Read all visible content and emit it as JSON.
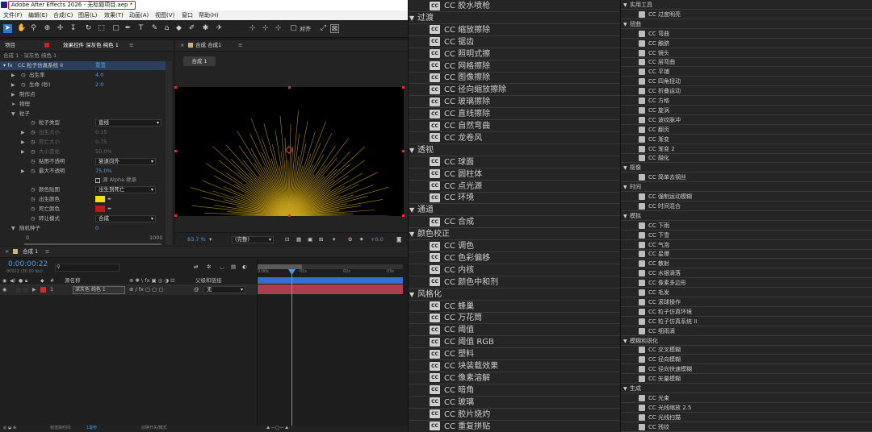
{
  "window": {
    "title": "Adobe After Effects 2026 - 无标题项目.aep *"
  },
  "menu": [
    "文件(F)",
    "编辑(E)",
    "合成(C)",
    "图层(L)",
    "效果(T)",
    "动画(A)",
    "视图(V)",
    "窗口",
    "帮助(H)"
  ],
  "toolbar": {
    "align_label": "对齐"
  },
  "project_panel": {
    "tab_project": "项目",
    "tab_effects": "效果控件 深灰色 纯色 1",
    "breadcrumb": "合成 1 · 深灰色 纯色 1",
    "effect_name": "CC 粒子仿真系统 II",
    "reset_label": "重置",
    "props": [
      {
        "label": "出生率",
        "value": "4.0"
      },
      {
        "label": "生命 (秒)",
        "value": "2.0"
      },
      {
        "label": "制作点",
        "value": ""
      },
      {
        "label": "物理",
        "value": ""
      },
      {
        "label": "粒子",
        "value": ""
      }
    ],
    "particle": {
      "type_label": "粒子类型",
      "type_value": "直线",
      "birth_size_label": "出生大小",
      "birth_size": "0.15",
      "death_size_label": "死亡大小",
      "death_size": "0.75",
      "size_var_label": "大小变化",
      "size_var": "50.0%",
      "opacity_map_label": "贴图不透明",
      "opacity_map_value": "衰退向外",
      "max_opacity_label": "最大不透明",
      "max_opacity": "75.0%",
      "alpha_label": "源 Alpha 继承",
      "color_map_label": "颜色贴图",
      "color_map_value": "出生到死亡",
      "birth_color_label": "出生颜色",
      "birth_color": "#f0e010",
      "death_color_label": "死亡颜色",
      "death_color": "#c01818",
      "transfer_label": "转让模式",
      "transfer_value": "合成"
    },
    "random_label": "随机种子",
    "random_value": "0",
    "slider_min": "0",
    "slider_max": "1000"
  },
  "viewer": {
    "tab_label": "合成 合成1",
    "comp_button": "合成 1",
    "zoom": "83.7 %",
    "quality": "(完整)",
    "exposure": "+0.0"
  },
  "timeline": {
    "tab_label": "合成 1",
    "timecode": "0:00:00:22",
    "timecode_sub": "00022 (30.00 fps)",
    "search_placeholder": "",
    "col_source": "源名称",
    "col_parent": "父级和链接",
    "layer_num": "1",
    "layer_name": "深灰色 纯色 1",
    "layer_parent": "无",
    "ruler": [
      "0:00s",
      "01s",
      "02s",
      "03s"
    ],
    "footer_render_label": "帧渲染时间:",
    "footer_render_value": "1毫秒",
    "footer_switch": "切换开关/模式"
  },
  "effects_list_left": [
    {
      "type": "item",
      "label": "CC 胶水喷枪"
    },
    {
      "type": "cat",
      "label": "过渡"
    },
    {
      "type": "item",
      "label": "CC 缩放擦除"
    },
    {
      "type": "item",
      "label": "CC 锯齿"
    },
    {
      "type": "item",
      "label": "CC 照明式擦"
    },
    {
      "type": "item",
      "label": "CC 网格擦除"
    },
    {
      "type": "item",
      "label": "CC 图像擦除"
    },
    {
      "type": "item",
      "label": "CC 径向缩放擦除"
    },
    {
      "type": "item",
      "label": "CC 玻璃擦除"
    },
    {
      "type": "item",
      "label": "CC 直线擦除"
    },
    {
      "type": "item",
      "label": "CC 自然弯曲"
    },
    {
      "type": "item",
      "label": "CC 龙卷风"
    },
    {
      "type": "cat",
      "label": "透视"
    },
    {
      "type": "item",
      "label": "CC 球面"
    },
    {
      "type": "item",
      "label": "CC 圆柱体"
    },
    {
      "type": "item",
      "label": "CC 点光源"
    },
    {
      "type": "item",
      "label": "CC 环境"
    },
    {
      "type": "cat",
      "label": "通道"
    },
    {
      "type": "item",
      "label": "CC 合成"
    },
    {
      "type": "cat",
      "label": "颜色校正"
    },
    {
      "type": "item",
      "label": "CC 调色"
    },
    {
      "type": "item",
      "label": "CC 色彩偏移"
    },
    {
      "type": "item",
      "label": "CC 内核"
    },
    {
      "type": "item",
      "label": "CC 颜色中和剂"
    },
    {
      "type": "cat",
      "label": "风格化"
    },
    {
      "type": "item",
      "label": "CC 蜂巢"
    },
    {
      "type": "item",
      "label": "CC 万花筒"
    },
    {
      "type": "item",
      "label": "CC 阈值"
    },
    {
      "type": "item",
      "label": "CC 阈值 RGB"
    },
    {
      "type": "item",
      "label": "CC 塑料"
    },
    {
      "type": "item",
      "label": "CC 块装载效果"
    },
    {
      "type": "item",
      "label": "CC 像素溶解"
    },
    {
      "type": "item",
      "label": "CC 暗角"
    },
    {
      "type": "item",
      "label": "CC 玻璃"
    },
    {
      "type": "item",
      "label": "CC 胶片烧灼"
    },
    {
      "type": "item",
      "label": "CC 重复拼贴"
    }
  ],
  "effects_list_right": [
    {
      "type": "cat",
      "label": "实用工具"
    },
    {
      "type": "item",
      "label": "CC 过度明亮"
    },
    {
      "type": "cat",
      "label": "扭曲"
    },
    {
      "type": "item",
      "label": "CC 弯曲"
    },
    {
      "type": "item",
      "label": "CC 触脐"
    },
    {
      "type": "item",
      "label": "CC 镜头"
    },
    {
      "type": "item",
      "label": "CC 层弯曲"
    },
    {
      "type": "item",
      "label": "CC 平铺"
    },
    {
      "type": "item",
      "label": "CC 四角扭动"
    },
    {
      "type": "item",
      "label": "CC 折叠运动"
    },
    {
      "type": "item",
      "label": "CC 方格"
    },
    {
      "type": "item",
      "label": "CC 旋涡"
    },
    {
      "type": "item",
      "label": "CC 波纹脉冲"
    },
    {
      "type": "item",
      "label": "CC 翻页"
    },
    {
      "type": "item",
      "label": "CC 渐变"
    },
    {
      "type": "item",
      "label": "CC 渐变 2"
    },
    {
      "type": "item",
      "label": "CC 融化"
    },
    {
      "type": "cat",
      "label": "抠像"
    },
    {
      "type": "item",
      "label": "CC 简单去钢丝"
    },
    {
      "type": "cat",
      "label": "时间"
    },
    {
      "type": "item",
      "label": "CC 强制运动模糊"
    },
    {
      "type": "item",
      "label": "CC 时间混合"
    },
    {
      "type": "cat",
      "label": "模拟"
    },
    {
      "type": "item",
      "label": "CC 下雨"
    },
    {
      "type": "item",
      "label": "CC 下雪"
    },
    {
      "type": "item",
      "label": "CC 气泡"
    },
    {
      "type": "item",
      "label": "CC 星爆"
    },
    {
      "type": "item",
      "label": "CC 散射"
    },
    {
      "type": "item",
      "label": "CC 水银滴落"
    },
    {
      "type": "item",
      "label": "CC 像素多边形"
    },
    {
      "type": "item",
      "label": "CC 毛发"
    },
    {
      "type": "item",
      "label": "CC 滚球操作"
    },
    {
      "type": "item",
      "label": "CC 粒子仿真环境"
    },
    {
      "type": "item",
      "label": "CC 粒子仿真系统 II"
    },
    {
      "type": "item",
      "label": "CC 细雨滴"
    },
    {
      "type": "cat",
      "label": "模糊和锐化"
    },
    {
      "type": "item",
      "label": "CC 交叉模糊"
    },
    {
      "type": "item",
      "label": "CC 径向模糊"
    },
    {
      "type": "item",
      "label": "CC 径向快速模糊"
    },
    {
      "type": "item",
      "label": "CC 矢量模糊"
    },
    {
      "type": "cat",
      "label": "生成"
    },
    {
      "type": "item",
      "label": "CC 光束"
    },
    {
      "type": "item",
      "label": "CC 光线缩放 2.5"
    },
    {
      "type": "item",
      "label": "CC 光线扫描"
    },
    {
      "type": "item",
      "label": "CC 残纹"
    }
  ]
}
